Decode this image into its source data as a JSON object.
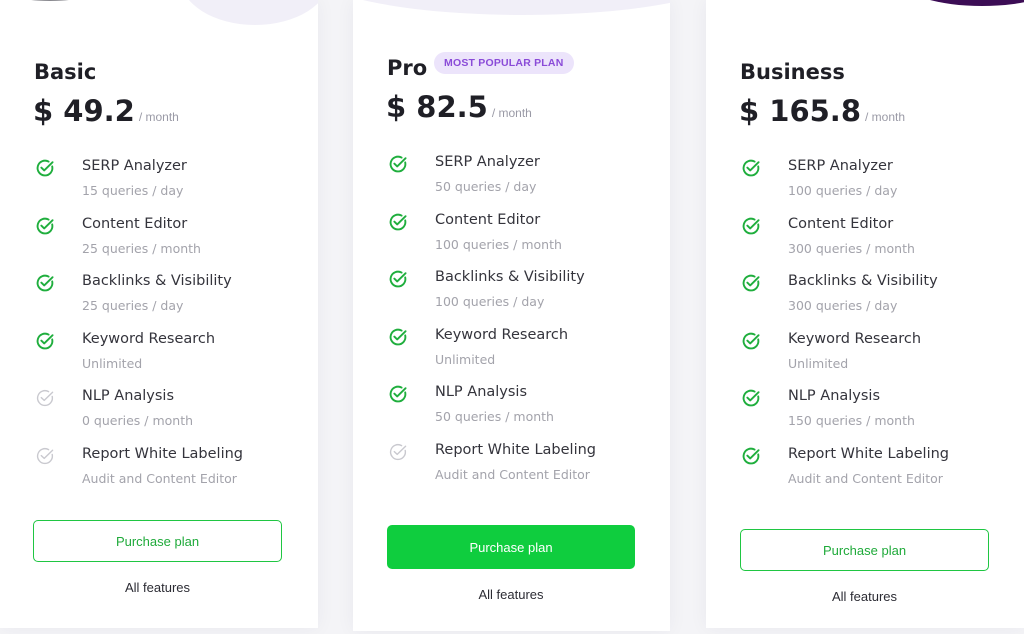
{
  "colors": {
    "accent_green": "#0fcd3e",
    "check_active": "#1fae3d",
    "check_inactive": "#c9c9cf",
    "badge_bg": "#ece4fb",
    "badge_text": "#8a4bd8"
  },
  "plans": [
    {
      "name": "Basic",
      "price": "$ 49.2",
      "period": "/ month",
      "button": "Purchase plan",
      "link": "All features",
      "features": [
        {
          "title": "SERP Analyzer",
          "sub": "15 queries / day",
          "included": true
        },
        {
          "title": "Content Editor",
          "sub": "25 queries / month",
          "included": true
        },
        {
          "title": "Backlinks & Visibility",
          "sub": "25 queries / day",
          "included": true
        },
        {
          "title": "Keyword Research",
          "sub": "Unlimited",
          "included": true
        },
        {
          "title": "NLP Analysis",
          "sub": "0 queries / month",
          "included": false
        },
        {
          "title": "Report White Labeling",
          "sub": "Audit and Content Editor",
          "included": false
        }
      ]
    },
    {
      "name": "Pro",
      "badge": "MOST POPULAR PLAN",
      "price": "$ 82.5",
      "period": "/ month",
      "button": "Purchase plan",
      "link": "All features",
      "features": [
        {
          "title": "SERP Analyzer",
          "sub": "50 queries / day",
          "included": true
        },
        {
          "title": "Content Editor",
          "sub": "100 queries / month",
          "included": true
        },
        {
          "title": "Backlinks & Visibility",
          "sub": "100 queries / day",
          "included": true
        },
        {
          "title": "Keyword Research",
          "sub": "Unlimited",
          "included": true
        },
        {
          "title": "NLP Analysis",
          "sub": "50 queries / month",
          "included": true
        },
        {
          "title": "Report White Labeling",
          "sub": "Audit and Content Editor",
          "included": false
        }
      ]
    },
    {
      "name": "Business",
      "price": "$ 165.8",
      "period": "/ month",
      "button": "Purchase plan",
      "link": "All features",
      "features": [
        {
          "title": "SERP Analyzer",
          "sub": "100 queries / day",
          "included": true
        },
        {
          "title": "Content Editor",
          "sub": "300 queries / month",
          "included": true
        },
        {
          "title": "Backlinks & Visibility",
          "sub": "300 queries / day",
          "included": true
        },
        {
          "title": "Keyword Research",
          "sub": "Unlimited",
          "included": true
        },
        {
          "title": "NLP Analysis",
          "sub": "150 queries / month",
          "included": true
        },
        {
          "title": "Report White Labeling",
          "sub": "Audit and Content Editor",
          "included": true
        }
      ]
    }
  ]
}
